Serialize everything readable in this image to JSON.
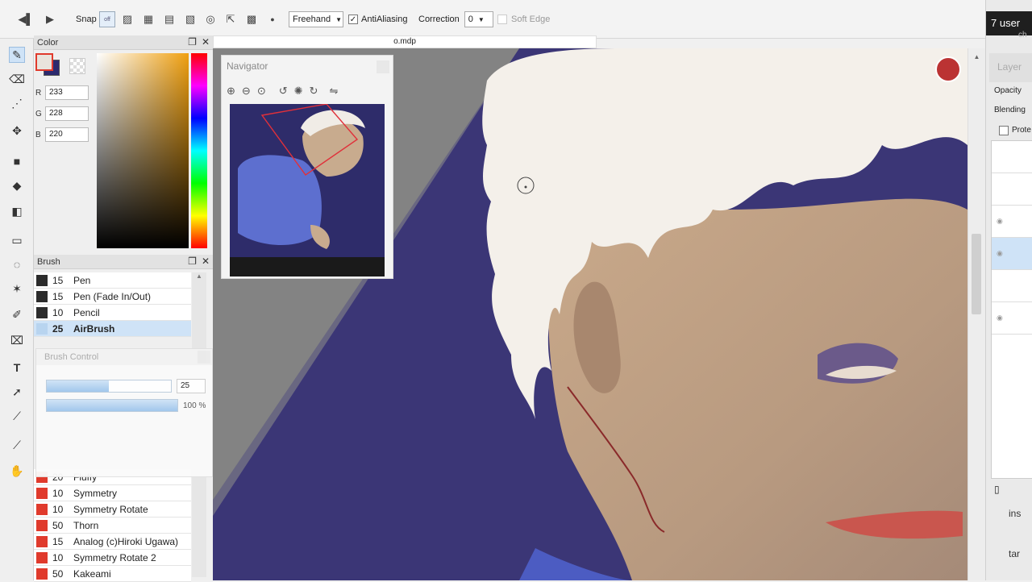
{
  "toolbar": {
    "snap_label": "Snap",
    "snap_state": "off",
    "brush_mode": "Freehand",
    "antialias_label": "AntiAliasing",
    "antialias_checked": "✓",
    "correction_label": "Correction",
    "correction_value": "0",
    "softedge_label": "Soft Edge"
  },
  "document": {
    "tab_title": "o.mdp"
  },
  "color_panel": {
    "title": "Color",
    "r_label": "R",
    "r_value": "233",
    "g_label": "G",
    "g_value": "228",
    "b_label": "B",
    "b_value": "220",
    "fg_color": "#e9e4dc",
    "bg_color": "#2c2a6e"
  },
  "brush_panel": {
    "title": "Brush",
    "items": [
      {
        "size": "15",
        "name": "Pen",
        "color": "#2b2b2b"
      },
      {
        "size": "15",
        "name": "Pen (Fade In/Out)",
        "color": "#2b2b2b"
      },
      {
        "size": "10",
        "name": "Pencil",
        "color": "#2b2b2b"
      },
      {
        "size": "25",
        "name": "AirBrush",
        "color": "#b8d4ef"
      },
      {
        "size": "20",
        "name": "Fluffy",
        "color": "#e03a2c"
      },
      {
        "size": "10",
        "name": "Symmetry",
        "color": "#e03a2c"
      },
      {
        "size": "10",
        "name": "Symmetry Rotate",
        "color": "#e03a2c"
      },
      {
        "size": "50",
        "name": "Thorn",
        "color": "#e03a2c"
      },
      {
        "size": "15",
        "name": "Analog (c)Hiroki Ugawa)",
        "color": "#e03a2c"
      },
      {
        "size": "10",
        "name": "Symmetry Rotate 2",
        "color": "#e03a2c"
      },
      {
        "size": "50",
        "name": "Kakeami",
        "color": "#e03a2c"
      }
    ]
  },
  "brush_control": {
    "title": "Brush Control",
    "size_value": "25",
    "size_fraction": 0.5,
    "opacity_value": "100 %",
    "opacity_fraction": 1.0
  },
  "navigator": {
    "title": "Navigator"
  },
  "right_panel": {
    "badge": "7 user",
    "sub": "ch",
    "layer_title": "Layer",
    "opacity_label": "Opacity",
    "blending_label": "Blending",
    "protect_label": "Prote",
    "footer_text_1": "ins",
    "footer_text_2": "tar"
  }
}
